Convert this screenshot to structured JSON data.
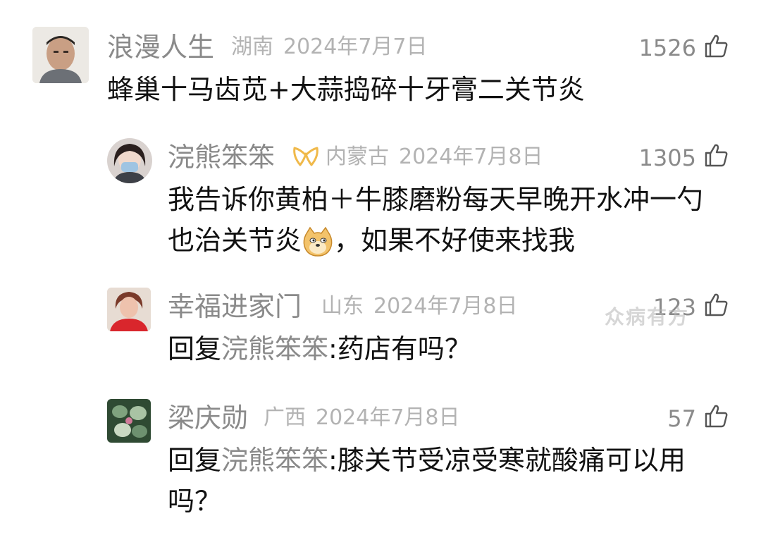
{
  "comments": [
    {
      "name": "浪漫人生",
      "location": "湖南",
      "date": "2024年7月7日",
      "likes": "1526",
      "text": "蜂巢十马齿苋+大蒜捣碎十牙膏二关节炎"
    },
    {
      "name": "浣熊笨笨",
      "location": "内蒙古",
      "date": "2024年7月8日",
      "likes": "1305",
      "text_line1": "我告诉你黄柏＋牛膝磨粉每天早晚开水冲一勺",
      "text_line2a": "也治关节炎",
      "text_line2b": "，如果不好使来找我"
    },
    {
      "name": "幸福进家门",
      "location": "山东",
      "date": "2024年7月8日",
      "likes": "123",
      "reply_prefix": "回复",
      "reply_to": "浣熊笨笨",
      "text": ":药店有吗？"
    },
    {
      "name": "梁庆勋",
      "location": "广西",
      "date": "2024年7月8日",
      "likes": "57",
      "reply_prefix": "回复",
      "reply_to": "浣熊笨笨",
      "text_line1": ":膝关节受凉受寒就酸痛可以用",
      "text_line2": "吗？"
    }
  ],
  "watermark": "众病有方",
  "icons": {
    "like": "thumbs-up-icon",
    "vip_badge": "vip-badge-icon",
    "emoji": "doge-emoji-icon"
  }
}
